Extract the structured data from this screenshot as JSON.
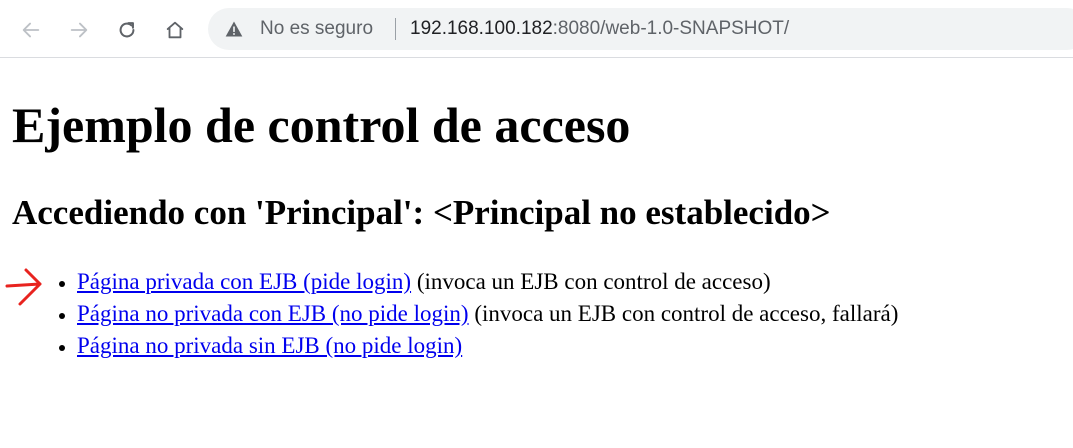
{
  "browser": {
    "security_label": "No es seguro",
    "url_host": "192.168.100.182",
    "url_rest": ":8080/web-1.0-SNAPSHOT/"
  },
  "page": {
    "title": "Ejemplo de control de acceso",
    "subtitle": "Accediendo con 'Principal': <Principal no establecido>",
    "links": [
      {
        "text": "Página privada con EJB (pide login)",
        "note": " (invoca un EJB con control de acceso)"
      },
      {
        "text": "Página no privada con EJB (no pide login)",
        "note": " (invoca un EJB con control de acceso, fallará)"
      },
      {
        "text": "Página no privada sin EJB (no pide login)",
        "note": ""
      }
    ]
  },
  "colors": {
    "link": "#0000ee",
    "annotation_arrow": "#e8231f",
    "omnibox_bg": "#f1f3f4"
  }
}
